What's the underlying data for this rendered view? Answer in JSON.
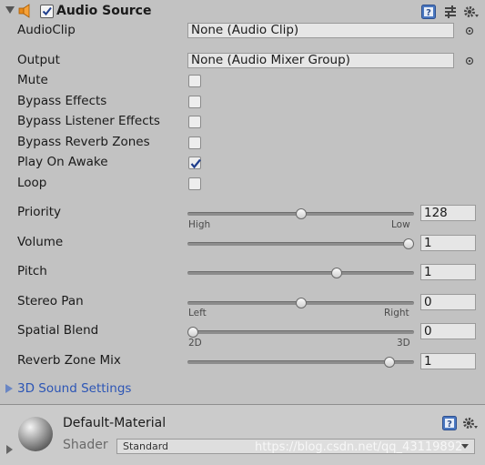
{
  "header": {
    "title": "Audio Source",
    "icons": [
      "fold-arrow",
      "speaker-icon",
      "enable-checkbox",
      "help-icon",
      "preset-icon",
      "gear-icon"
    ]
  },
  "fields": {
    "audioclip": {
      "label": "AudioClip",
      "value": "None (Audio Clip)"
    },
    "output": {
      "label": "Output",
      "value": "None (Audio Mixer Group)"
    }
  },
  "toggles": {
    "mute": {
      "label": "Mute",
      "checked": false
    },
    "bypass_effects": {
      "label": "Bypass Effects",
      "checked": false
    },
    "bypass_listener_effects": {
      "label": "Bypass Listener Effects",
      "checked": false
    },
    "bypass_reverb_zones": {
      "label": "Bypass Reverb Zones",
      "checked": false
    },
    "play_on_awake": {
      "label": "Play On Awake",
      "checked": true
    },
    "loop": {
      "label": "Loop",
      "checked": false
    }
  },
  "sliders": {
    "priority": {
      "label": "Priority",
      "value": "128",
      "fraction": 0.5,
      "min_label": "High",
      "max_label": "Low"
    },
    "volume": {
      "label": "Volume",
      "value": "1",
      "fraction": 1.0
    },
    "pitch": {
      "label": "Pitch",
      "value": "1",
      "fraction": 0.667
    },
    "stereo_pan": {
      "label": "Stereo Pan",
      "value": "0",
      "fraction": 0.5,
      "min_label": "Left",
      "max_label": "Right"
    },
    "spatial_blend": {
      "label": "Spatial Blend",
      "value": "0",
      "fraction": 0.0,
      "min_label": "2D",
      "max_label": "3D"
    },
    "reverb_zone_mix": {
      "label": "Reverb Zone Mix",
      "value": "1",
      "fraction": 0.91
    }
  },
  "foldout": {
    "label": "3D Sound Settings"
  },
  "material": {
    "name": "Default-Material",
    "shader_label": "Shader",
    "shader_value": "Standard"
  },
  "watermark": "https://blog.csdn.net/qq_43119892",
  "colors": {
    "background": "#c2c2c2",
    "link": "#2c55b5",
    "check_blue": "#1f3e8c"
  }
}
